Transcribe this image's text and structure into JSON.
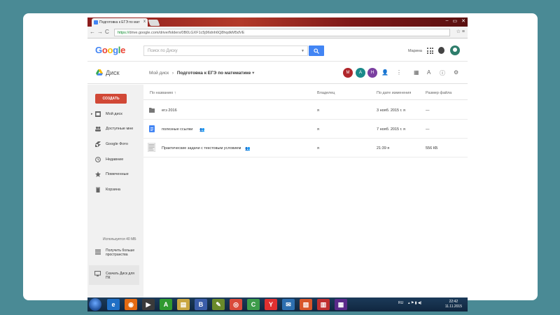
{
  "browser": {
    "tab_title": "Подготовка к ЕГЭ по мат",
    "tab_close": "x",
    "url_scheme": "https://",
    "url_rest": "drive.google.com/drive/folders/0B0LGXF1c5j96dnh6Q8hqdkM5dVE"
  },
  "google_header": {
    "logo": "Google",
    "search_placeholder": "Поиск по Диску",
    "user_name": "Марина"
  },
  "drive_toolbar": {
    "app_label": "Диск",
    "breadcrumb_root": "Мой диск",
    "breadcrumb_current": "Подготовка к ЕГЭ по математике",
    "collaborators": [
      {
        "initial": "М",
        "color": "#b0262b"
      },
      {
        "initial": "А",
        "color": "#1b8a8a"
      },
      {
        "initial": "Н",
        "color": "#7b3fa0"
      }
    ]
  },
  "sidebar": {
    "create_label": "СОЗДАТЬ",
    "items": [
      {
        "label": "Мой диск"
      },
      {
        "label": "Доступные мне"
      },
      {
        "label": "Google Фото"
      },
      {
        "label": "Недавние"
      },
      {
        "label": "Помеченные"
      },
      {
        "label": "Корзина"
      }
    ],
    "storage_text": "Используется 40 МБ",
    "more_space_label": "Получить больше пространства",
    "download_label": "Скачать Диск для ПК"
  },
  "file_list": {
    "columns": {
      "name": "По названию",
      "owner": "Владелец",
      "modified": "По дате изменения",
      "size": "Размер файла"
    },
    "rows": [
      {
        "name": "егэ 2016",
        "owner": "я",
        "modified": "3 нояб. 2015 г. я",
        "size": "—"
      },
      {
        "name": "полезные ссылки",
        "owner": "я",
        "modified": "7 нояб. 2015 г. я",
        "size": "—"
      },
      {
        "name": "Практические задачи с текстовым условием",
        "owner": "я",
        "modified": "21:39 я",
        "size": "556 КБ"
      }
    ]
  },
  "taskbar": {
    "apps": [
      {
        "glyph": "e",
        "color": "#1f6fc5"
      },
      {
        "glyph": "◉",
        "color": "#e36a12"
      },
      {
        "glyph": "▶",
        "color": "#3a3a3a"
      },
      {
        "glyph": "A",
        "color": "#2f9a2f"
      },
      {
        "glyph": "▤",
        "color": "#c9a640"
      },
      {
        "glyph": "B",
        "color": "#3b5da8"
      },
      {
        "glyph": "✎",
        "color": "#6a8a2a"
      },
      {
        "glyph": "◎",
        "color": "#d94a3a"
      },
      {
        "glyph": "C",
        "color": "#3d9c4a"
      },
      {
        "glyph": "Y",
        "color": "#e03030"
      },
      {
        "glyph": "✉",
        "color": "#2d6fb0"
      },
      {
        "glyph": "▧",
        "color": "#d8562a"
      },
      {
        "glyph": "▥",
        "color": "#c03030"
      },
      {
        "glyph": "▦",
        "color": "#5a2a8a"
      }
    ],
    "lang": "RU",
    "time": "22:42",
    "date": "11.11.2015"
  }
}
